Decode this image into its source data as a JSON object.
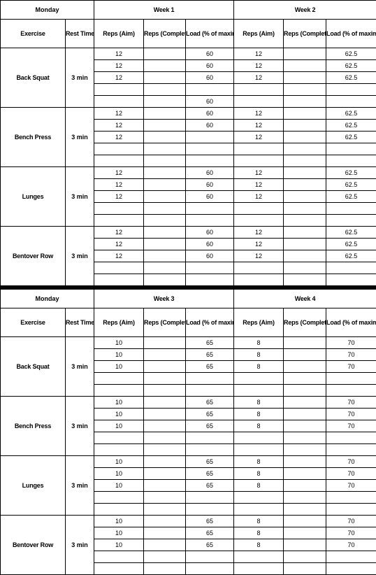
{
  "theme": {
    "accent": "#00a9e8",
    "header_bg": "#050505",
    "header_fg": "#ffffff",
    "grid": "#000000",
    "cell_bg": "#ffffff"
  },
  "tables": [
    {
      "day": "Monday",
      "week_groups": [
        "Week 1",
        "Week 2"
      ],
      "columns": [
        "Exercise",
        "Rest Time",
        "Reps (Aim)",
        "Reps (Completed)",
        "Load (% of maximum)",
        "Reps (Aim)",
        "Reps (Completed)",
        "Load (% of maximum)"
      ],
      "blocks": [
        {
          "exercise": "Back Squat",
          "rest": "3 min",
          "rows": [
            {
              "reps_aim_a": "12",
              "reps_done_a": "",
              "load_a": "60",
              "reps_aim_b": "12",
              "reps_done_b": "",
              "load_b": "62.5"
            },
            {
              "reps_aim_a": "12",
              "reps_done_a": "",
              "load_a": "60",
              "reps_aim_b": "12",
              "reps_done_b": "",
              "load_b": "62.5"
            },
            {
              "reps_aim_a": "12",
              "reps_done_a": "",
              "load_a": "60",
              "reps_aim_b": "12",
              "reps_done_b": "",
              "load_b": "62.5"
            },
            {
              "reps_aim_a": "",
              "reps_done_a": "",
              "load_a": "",
              "reps_aim_b": "",
              "reps_done_b": "",
              "load_b": ""
            },
            {
              "reps_aim_a": "",
              "reps_done_a": "",
              "load_a": "60",
              "reps_aim_b": "",
              "reps_done_b": "",
              "load_b": ""
            }
          ]
        },
        {
          "exercise": "Bench Press",
          "rest": "3 min",
          "rows": [
            {
              "reps_aim_a": "12",
              "reps_done_a": "",
              "load_a": "60",
              "reps_aim_b": "12",
              "reps_done_b": "",
              "load_b": "62.5"
            },
            {
              "reps_aim_a": "12",
              "reps_done_a": "",
              "load_a": "60",
              "reps_aim_b": "12",
              "reps_done_b": "",
              "load_b": "62.5"
            },
            {
              "reps_aim_a": "12",
              "reps_done_a": "",
              "load_a": "",
              "reps_aim_b": "12",
              "reps_done_b": "",
              "load_b": "62.5"
            },
            {
              "reps_aim_a": "",
              "reps_done_a": "",
              "load_a": "",
              "reps_aim_b": "",
              "reps_done_b": "",
              "load_b": ""
            },
            {
              "reps_aim_a": "",
              "reps_done_a": "",
              "load_a": "",
              "reps_aim_b": "",
              "reps_done_b": "",
              "load_b": ""
            }
          ]
        },
        {
          "exercise": "Lunges",
          "rest": "3 min",
          "rows": [
            {
              "reps_aim_a": "12",
              "reps_done_a": "",
              "load_a": "60",
              "reps_aim_b": "12",
              "reps_done_b": "",
              "load_b": "62.5"
            },
            {
              "reps_aim_a": "12",
              "reps_done_a": "",
              "load_a": "60",
              "reps_aim_b": "12",
              "reps_done_b": "",
              "load_b": "62.5"
            },
            {
              "reps_aim_a": "12",
              "reps_done_a": "",
              "load_a": "60",
              "reps_aim_b": "12",
              "reps_done_b": "",
              "load_b": "62.5"
            },
            {
              "reps_aim_a": "",
              "reps_done_a": "",
              "load_a": "",
              "reps_aim_b": "",
              "reps_done_b": "",
              "load_b": ""
            },
            {
              "reps_aim_a": "",
              "reps_done_a": "",
              "load_a": "",
              "reps_aim_b": "",
              "reps_done_b": "",
              "load_b": ""
            }
          ]
        },
        {
          "exercise": "Bentover Row",
          "rest": "3 min",
          "rows": [
            {
              "reps_aim_a": "12",
              "reps_done_a": "",
              "load_a": "60",
              "reps_aim_b": "12",
              "reps_done_b": "",
              "load_b": "62.5"
            },
            {
              "reps_aim_a": "12",
              "reps_done_a": "",
              "load_a": "60",
              "reps_aim_b": "12",
              "reps_done_b": "",
              "load_b": "62.5"
            },
            {
              "reps_aim_a": "12",
              "reps_done_a": "",
              "load_a": "60",
              "reps_aim_b": "12",
              "reps_done_b": "",
              "load_b": "62.5"
            },
            {
              "reps_aim_a": "",
              "reps_done_a": "",
              "load_a": "",
              "reps_aim_b": "",
              "reps_done_b": "",
              "load_b": ""
            },
            {
              "reps_aim_a": "",
              "reps_done_a": "",
              "load_a": "",
              "reps_aim_b": "",
              "reps_done_b": "",
              "load_b": ""
            }
          ]
        }
      ]
    },
    {
      "day": "Monday",
      "week_groups": [
        "Week 3",
        "Week 4"
      ],
      "columns": [
        "Exercise",
        "Rest Time",
        "Reps (Aim)",
        "Reps (Completed)",
        "Load (% of maximum)",
        "Reps (Aim)",
        "Reps (Completed)",
        "Load (% of maximum)"
      ],
      "blocks": [
        {
          "exercise": "Back Squat",
          "rest": "3 min",
          "rows": [
            {
              "reps_aim_a": "10",
              "reps_done_a": "",
              "load_a": "65",
              "reps_aim_b": "8",
              "reps_done_b": "",
              "load_b": "70"
            },
            {
              "reps_aim_a": "10",
              "reps_done_a": "",
              "load_a": "65",
              "reps_aim_b": "8",
              "reps_done_b": "",
              "load_b": "70"
            },
            {
              "reps_aim_a": "10",
              "reps_done_a": "",
              "load_a": "65",
              "reps_aim_b": "8",
              "reps_done_b": "",
              "load_b": "70"
            },
            {
              "reps_aim_a": "",
              "reps_done_a": "",
              "load_a": "",
              "reps_aim_b": "",
              "reps_done_b": "",
              "load_b": ""
            },
            {
              "reps_aim_a": "",
              "reps_done_a": "",
              "load_a": "",
              "reps_aim_b": "",
              "reps_done_b": "",
              "load_b": ""
            }
          ]
        },
        {
          "exercise": "Bench Press",
          "rest": "3 min",
          "rows": [
            {
              "reps_aim_a": "10",
              "reps_done_a": "",
              "load_a": "65",
              "reps_aim_b": "8",
              "reps_done_b": "",
              "load_b": "70"
            },
            {
              "reps_aim_a": "10",
              "reps_done_a": "",
              "load_a": "65",
              "reps_aim_b": "8",
              "reps_done_b": "",
              "load_b": "70"
            },
            {
              "reps_aim_a": "10",
              "reps_done_a": "",
              "load_a": "65",
              "reps_aim_b": "8",
              "reps_done_b": "",
              "load_b": "70"
            },
            {
              "reps_aim_a": "",
              "reps_done_a": "",
              "load_a": "",
              "reps_aim_b": "",
              "reps_done_b": "",
              "load_b": ""
            },
            {
              "reps_aim_a": "",
              "reps_done_a": "",
              "load_a": "",
              "reps_aim_b": "",
              "reps_done_b": "",
              "load_b": ""
            }
          ]
        },
        {
          "exercise": "Lunges",
          "rest": "3 min",
          "rows": [
            {
              "reps_aim_a": "10",
              "reps_done_a": "",
              "load_a": "65",
              "reps_aim_b": "8",
              "reps_done_b": "",
              "load_b": "70"
            },
            {
              "reps_aim_a": "10",
              "reps_done_a": "",
              "load_a": "65",
              "reps_aim_b": "8",
              "reps_done_b": "",
              "load_b": "70"
            },
            {
              "reps_aim_a": "10",
              "reps_done_a": "",
              "load_a": "65",
              "reps_aim_b": "8",
              "reps_done_b": "",
              "load_b": "70"
            },
            {
              "reps_aim_a": "",
              "reps_done_a": "",
              "load_a": "",
              "reps_aim_b": "",
              "reps_done_b": "",
              "load_b": ""
            },
            {
              "reps_aim_a": "",
              "reps_done_a": "",
              "load_a": "",
              "reps_aim_b": "",
              "reps_done_b": "",
              "load_b": ""
            }
          ]
        },
        {
          "exercise": "Bentover Row",
          "rest": "3 min",
          "rows": [
            {
              "reps_aim_a": "10",
              "reps_done_a": "",
              "load_a": "65",
              "reps_aim_b": "8",
              "reps_done_b": "",
              "load_b": "70"
            },
            {
              "reps_aim_a": "10",
              "reps_done_a": "",
              "load_a": "65",
              "reps_aim_b": "8",
              "reps_done_b": "",
              "load_b": "70"
            },
            {
              "reps_aim_a": "10",
              "reps_done_a": "",
              "load_a": "65",
              "reps_aim_b": "8",
              "reps_done_b": "",
              "load_b": "70"
            },
            {
              "reps_aim_a": "",
              "reps_done_a": "",
              "load_a": "",
              "reps_aim_b": "",
              "reps_done_b": "",
              "load_b": ""
            },
            {
              "reps_aim_a": "",
              "reps_done_a": "",
              "load_a": "",
              "reps_aim_b": "",
              "reps_done_b": "",
              "load_b": ""
            }
          ]
        }
      ]
    }
  ]
}
